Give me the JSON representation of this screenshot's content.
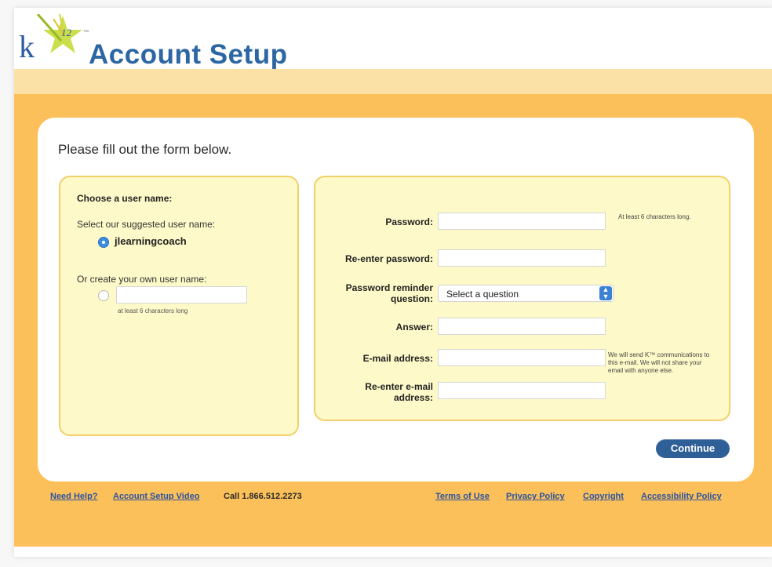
{
  "header": {
    "logo_text": "k12",
    "logo_tm": "™",
    "title": "Account Setup"
  },
  "form": {
    "intro": "Please fill out the form below.",
    "left_panel": {
      "heading": "Choose a user name:",
      "suggest_label": "Select our suggested user name:",
      "suggested_name": "jlearningcoach",
      "own_label": "Or create your own user name:",
      "own_value": "",
      "own_hint": "at least 6 characters long"
    },
    "right_panel": {
      "password_label": "Password:",
      "password_hint": "At least 6 characters long.",
      "reenter_password_label": "Re-enter password:",
      "reminder_label_1": "Password reminder",
      "reminder_label_2": "question:",
      "reminder_selected": "Select a question",
      "answer_label": "Answer:",
      "email_label": "E-mail address:",
      "reenter_email_label_1": "Re-enter e-mail",
      "reenter_email_label_2": "address:",
      "email_hint": "We will send K™ communications to this e-mail. We will not share your email with anyone else."
    },
    "continue_label": "Continue"
  },
  "footer": {
    "need_help": "Need Help?",
    "setup_video": "Account Setup Video",
    "call": "Call 1.866.512.2273",
    "terms": "Terms of Use",
    "privacy": "Privacy Policy",
    "copyright": "Copyright",
    "accessibility": "Accessibility Policy"
  },
  "colors": {
    "accent_orange": "#fcc05a",
    "light_band": "#fbe1a6",
    "panel_fill": "#fef9c8",
    "title_blue": "#2c66a3",
    "button_blue": "#2e5f97",
    "radio_blue": "#3d8ee0"
  }
}
